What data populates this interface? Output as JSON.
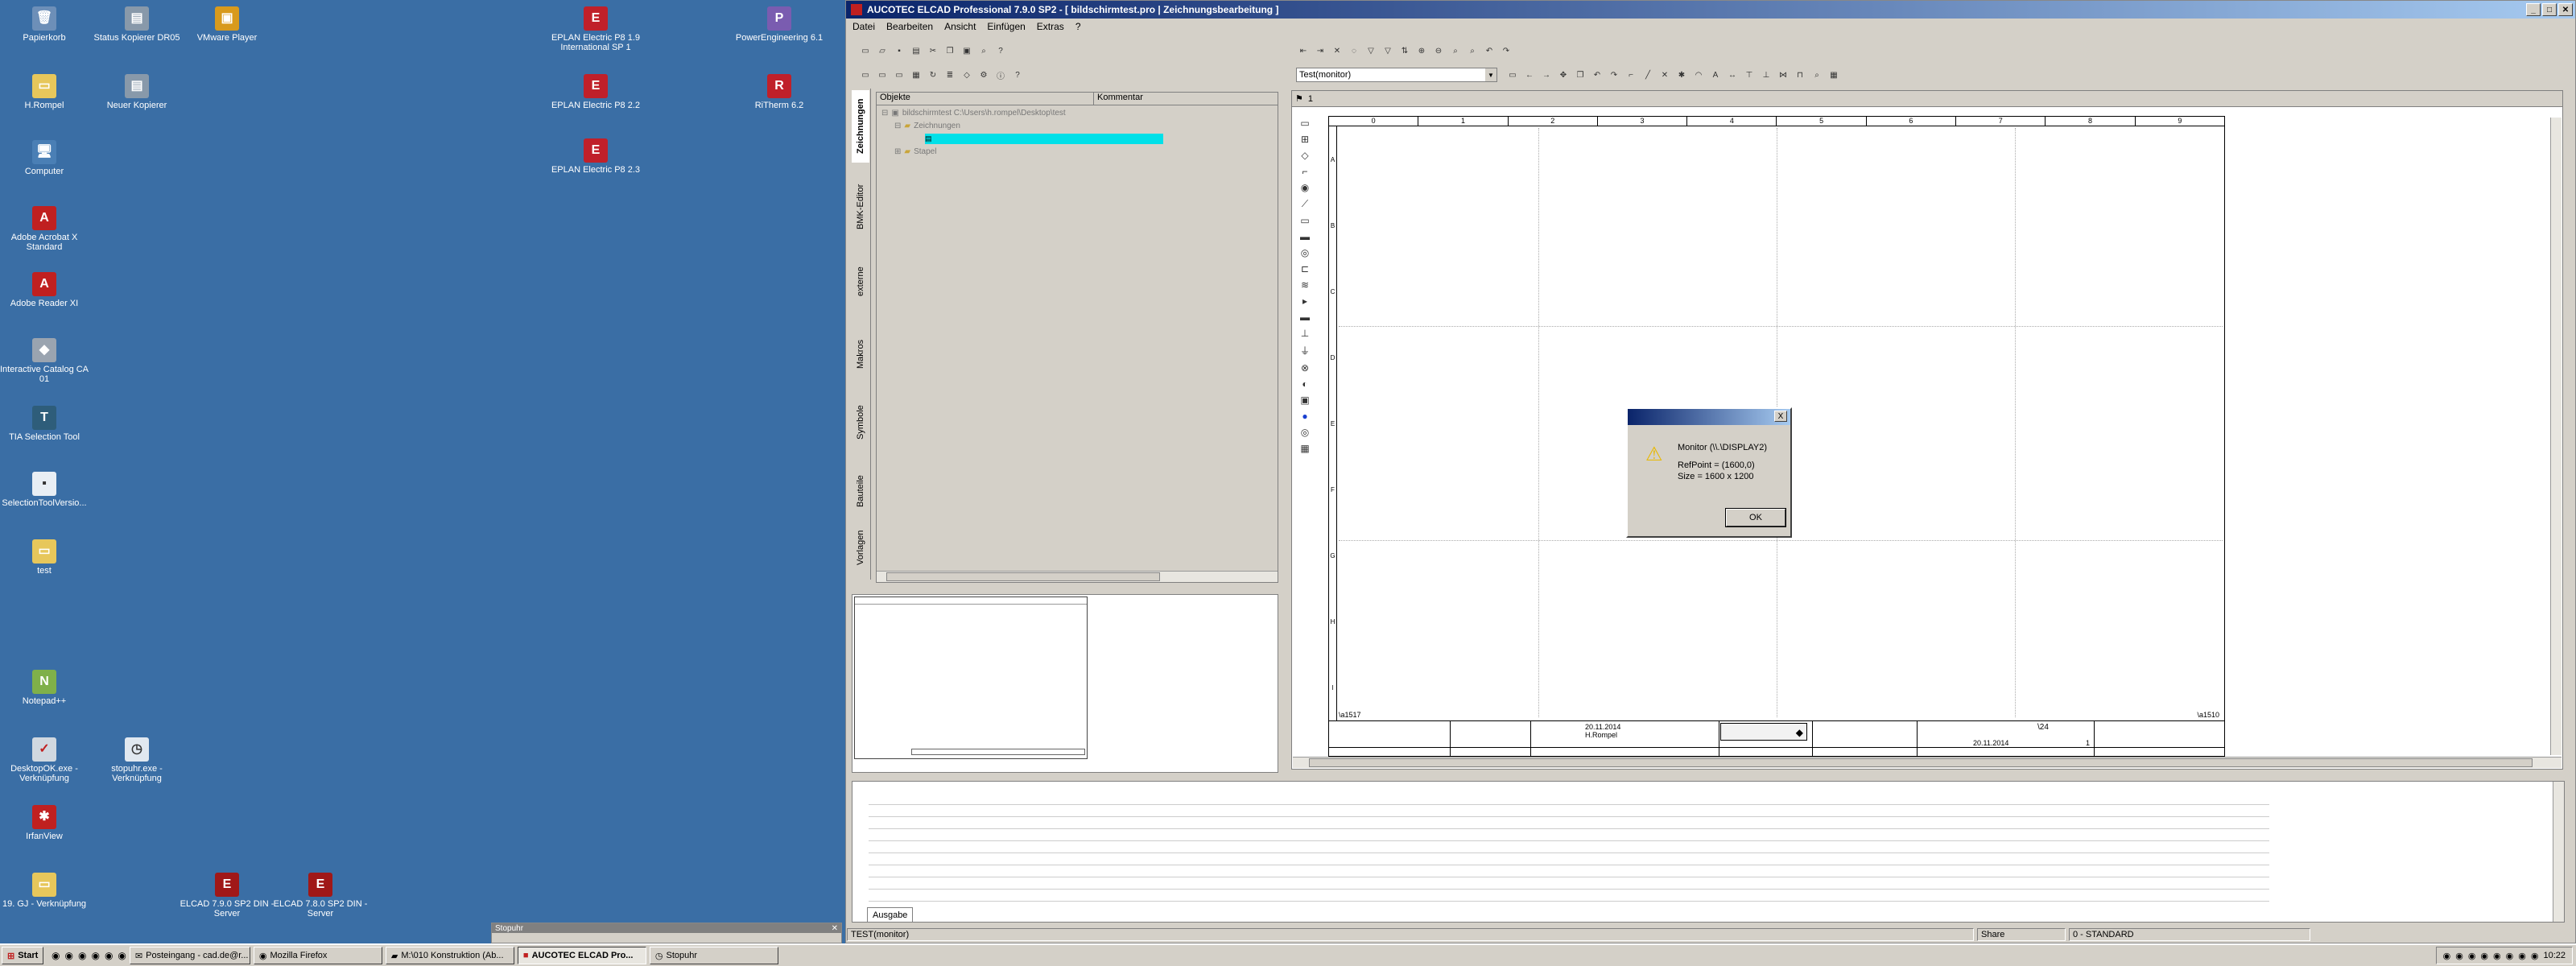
{
  "desktop": {
    "icons": [
      {
        "label": "Papierkorb",
        "icon": "recycle-bin-icon"
      },
      {
        "label": "Status Kopierer DR05",
        "icon": "printer-icon"
      },
      {
        "label": "VMware Player",
        "icon": "vmware-icon"
      },
      {
        "label": "EPLAN Electric P8 1.9 International SP 1",
        "icon": "eplan-icon"
      },
      {
        "label": "PowerEngineering 6.1",
        "icon": "app-icon"
      },
      {
        "label": "H.Rompel",
        "icon": "folder-icon"
      },
      {
        "label": "Neuer Kopierer",
        "icon": "printer-icon"
      },
      {
        "label": "EPLAN Electric P8 2.2",
        "icon": "eplan-icon"
      },
      {
        "label": "RiTherm 6.2",
        "icon": "app-icon"
      },
      {
        "label": "EPLAN Electric P8 2.3",
        "icon": "eplan-icon"
      },
      {
        "label": "Computer",
        "icon": "computer-icon"
      },
      {
        "label": "Adobe Acrobat X Standard",
        "icon": "acrobat-icon"
      },
      {
        "label": "Adobe Reader XI",
        "icon": "reader-icon"
      },
      {
        "label": "Interactive Catalog CA 01",
        "icon": "catalog-icon"
      },
      {
        "label": "TIA Selection Tool",
        "icon": "tia-icon"
      },
      {
        "label": "SelectionToolVersio...",
        "icon": "file-icon"
      },
      {
        "label": "test",
        "icon": "folder-icon"
      },
      {
        "label": "Notepad++",
        "icon": "notepad-icon"
      },
      {
        "label": "DesktopOK.exe - Verknüpfung",
        "icon": "desktopok-icon"
      },
      {
        "label": "stopuhr.exe - Verknüpfung",
        "icon": "stopwatch-icon"
      },
      {
        "label": "IrfanView",
        "icon": "irfanview-icon"
      },
      {
        "label": "19. GJ - Verknüpfung",
        "icon": "folder-icon"
      },
      {
        "label": "ELCAD 7.9.0 SP2 DIN - Server",
        "icon": "elcad-icon"
      },
      {
        "label": "ELCAD 7.8.0 SP2 DIN - Server",
        "icon": "elcad-icon"
      }
    ],
    "stopuhr_label": "Stopuhr"
  },
  "window": {
    "title": "AUCOTEC   ELCAD Professional 7.9.0 SP2 - [ bildschirmtest.pro | Zeichnungsbearbeitung ]",
    "menu": [
      "Datei",
      "Bearbeiten",
      "Ansicht",
      "Einfügen",
      "Extras",
      "?"
    ],
    "combo_value": "Test(monitor)",
    "tree": {
      "col_objects": "Objekte",
      "col_comment": "Kommentar",
      "root": "bildschirmtest  C:\\Users\\h.rompel\\Desktop\\test",
      "child1": "Zeichnungen",
      "child2": "Stapel"
    },
    "vtabs": [
      "Zeichnungen",
      "BMK-Editor",
      "externe",
      "Makros",
      "Symbole",
      "Bauteile",
      "Vorlagen"
    ],
    "drawing_tab": "1",
    "column_numbers": [
      "0",
      "1",
      "2",
      "3",
      "4",
      "5",
      "6",
      "7",
      "8",
      "9"
    ],
    "row_letters": [
      "A",
      "B",
      "C",
      "D",
      "E",
      "F",
      "G",
      "H",
      "I"
    ],
    "corner_left": "\\a1517",
    "corner_right": "\\a1510",
    "titleblock": {
      "date1": "20.11.2014",
      "name1": "H.Rompel",
      "ref": "\\24",
      "date2": "20.11.2014",
      "num": "1"
    },
    "output_tab": "Ausgabe",
    "status": {
      "left": "TEST(monitor)",
      "share": "Share",
      "standard": "0 - STANDARD"
    }
  },
  "dialog": {
    "line1": "Monitor (\\\\.\\DISPLAY2)",
    "line2": "RefPoint = (1600,0)",
    "line3": "Size = 1600 x 1200",
    "ok": "OK",
    "close": "X"
  },
  "taskbar": {
    "start": "Start",
    "tasks": [
      "Posteingang - cad.de@r...",
      "Mozilla Firefox",
      "M:\\010 Konstruktion (Ab...",
      "AUCOTEC   ELCAD Pro...",
      "Stopuhr"
    ],
    "clock": "10:22"
  }
}
